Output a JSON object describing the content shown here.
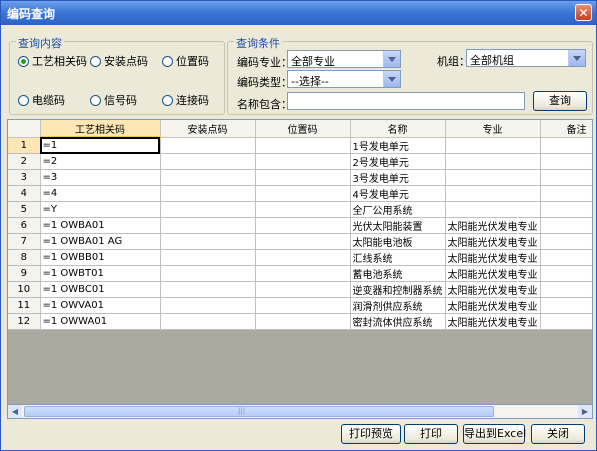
{
  "window": {
    "title": "编码查询",
    "close": "✕"
  },
  "query_content": {
    "label": "查询内容",
    "options": [
      {
        "label": "工艺相关码",
        "checked": true
      },
      {
        "label": "安装点码",
        "checked": false
      },
      {
        "label": "位置码",
        "checked": false
      },
      {
        "label": "电缆码",
        "checked": false
      },
      {
        "label": "信号码",
        "checked": false
      },
      {
        "label": "连接码",
        "checked": false
      }
    ]
  },
  "query_conditions": {
    "label": "查询条件",
    "specialty_label": "编码专业：",
    "specialty_value": "全部专业",
    "unit_label": "机组：",
    "unit_value": "全部机组",
    "code_type_label": "编码类型：",
    "code_type_value": "--选择--",
    "name_contains_label": "名称包含：",
    "name_contains_value": "",
    "search_button": "查询"
  },
  "grid": {
    "columns": [
      "工艺相关码",
      "安装点码",
      "位置码",
      "名称",
      "专业",
      "备注"
    ],
    "rows": [
      {
        "num": "1",
        "code": "=1",
        "install": "",
        "location": "",
        "name": "1号发电单元",
        "specialty": ""
      },
      {
        "num": "2",
        "code": "=2",
        "install": "",
        "location": "",
        "name": "2号发电单元",
        "specialty": ""
      },
      {
        "num": "3",
        "code": "=3",
        "install": "",
        "location": "",
        "name": "3号发电单元",
        "specialty": ""
      },
      {
        "num": "4",
        "code": "=4",
        "install": "",
        "location": "",
        "name": "4号发电单元",
        "specialty": ""
      },
      {
        "num": "5",
        "code": "=Y",
        "install": "",
        "location": "",
        "name": "全厂公用系统",
        "specialty": ""
      },
      {
        "num": "6",
        "code": "=1 OWBA01",
        "install": "",
        "location": "",
        "name": "光伏太阳能装置",
        "specialty": "太阳能光伏发电专业"
      },
      {
        "num": "7",
        "code": "=1 OWBA01 AG",
        "install": "",
        "location": "",
        "name": "太阳能电池板",
        "specialty": "太阳能光伏发电专业"
      },
      {
        "num": "8",
        "code": "=1 OWBB01",
        "install": "",
        "location": "",
        "name": "汇线系统",
        "specialty": "太阳能光伏发电专业"
      },
      {
        "num": "9",
        "code": "=1 OWBT01",
        "install": "",
        "location": "",
        "name": "蓄电池系统",
        "specialty": "太阳能光伏发电专业"
      },
      {
        "num": "10",
        "code": "=1 OWBC01",
        "install": "",
        "location": "",
        "name": "逆变器和控制器系统",
        "specialty": "太阳能光伏发电专业"
      },
      {
        "num": "11",
        "code": "=1 OWVA01",
        "install": "",
        "location": "",
        "name": "润滑剂供应系统",
        "specialty": "太阳能光伏发电专业"
      },
      {
        "num": "12",
        "code": "=1 OWWA01",
        "install": "",
        "location": "",
        "name": "密封流体供应系统",
        "specialty": "太阳能光伏发电专业"
      }
    ]
  },
  "buttons": {
    "print_preview": "打印预览",
    "print": "打印",
    "export_excel": "导出到Excel",
    "close": "关闭"
  }
}
